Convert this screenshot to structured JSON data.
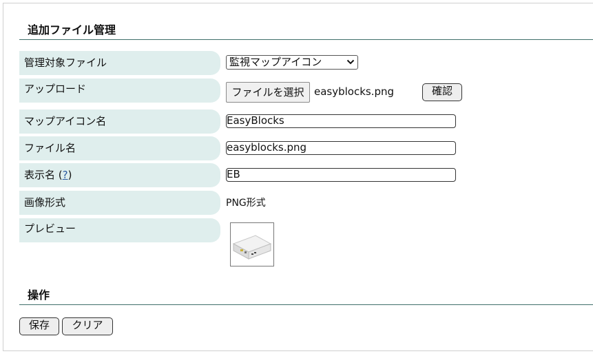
{
  "section1": {
    "title": "追加ファイル管理"
  },
  "rows": {
    "target": {
      "label": "管理対象ファイル",
      "select_value": "監視マップアイコン"
    },
    "upload": {
      "label": "アップロード",
      "choose_label": "ファイルを選択",
      "chosen_file": "easyblocks.png",
      "confirm_label": "確認"
    },
    "icon_name": {
      "label": "マップアイコン名",
      "value": "EasyBlocks"
    },
    "file_name": {
      "label": "ファイル名",
      "value": "easyblocks.png"
    },
    "display_name": {
      "label": "表示名",
      "help_open": "(",
      "help_link": "?",
      "help_close": ")",
      "value": "EB"
    },
    "image_format": {
      "label": "画像形式",
      "value": "PNG形式"
    },
    "preview": {
      "label": "プレビュー"
    }
  },
  "section2": {
    "title": "操作"
  },
  "actions": {
    "save_label": "保存",
    "clear_label": "クリア"
  },
  "colors": {
    "label_bg": "#dfeeed",
    "rule": "#3f6f6a",
    "link": "#2a5aa0"
  },
  "icons": {
    "select": "chevron-down-icon",
    "preview": "router-device-icon"
  }
}
